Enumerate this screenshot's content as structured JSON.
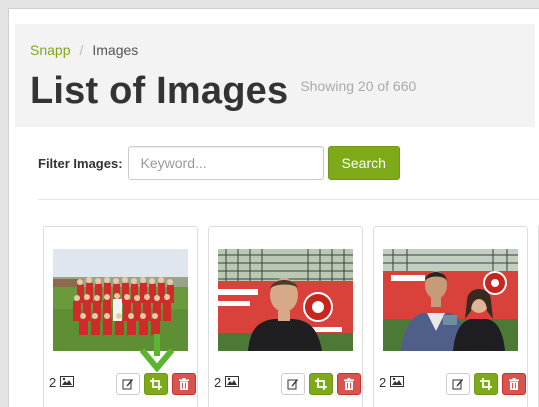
{
  "breadcrumb": {
    "root": "Snapp",
    "separator": "/",
    "current": "Images"
  },
  "page": {
    "title": "List of Images",
    "showing": "Showing 20 of 660"
  },
  "filter": {
    "label": "Filter Images:",
    "placeholder": "Keyword...",
    "value": "",
    "button": "Search"
  },
  "cards": [
    {
      "count": "2",
      "photo": "team-photo",
      "actions": [
        "edit",
        "crop",
        "delete"
      ]
    },
    {
      "count": "2",
      "photo": "man-portrait",
      "actions": [
        "edit",
        "crop",
        "delete"
      ]
    },
    {
      "count": "2",
      "photo": "award-presentation",
      "actions": [
        "edit",
        "crop",
        "delete"
      ]
    }
  ],
  "colors": {
    "accent": "#7eaa19",
    "danger": "#d9534f",
    "link": "#7fa819",
    "annotation_arrow": "#5cb531"
  },
  "icons": [
    "image-icon",
    "edit-icon",
    "crop-icon",
    "trash-icon",
    "down-arrow-icon"
  ]
}
